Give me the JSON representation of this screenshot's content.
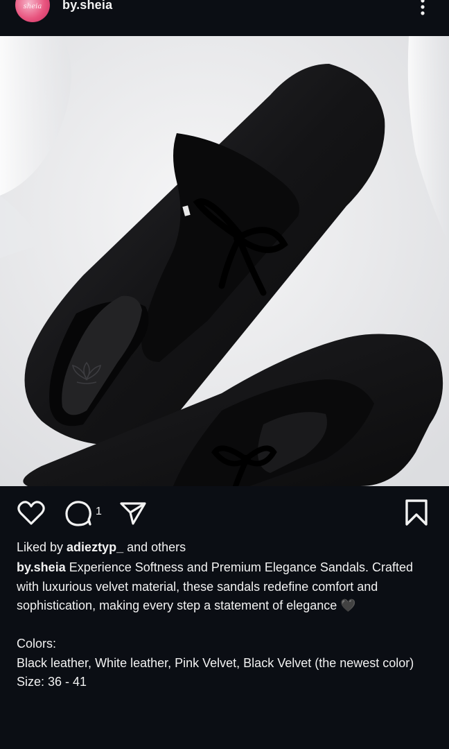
{
  "header": {
    "avatar_text": "sheia",
    "username": "by.sheia",
    "more_icon": "vertical-dots-icon"
  },
  "post": {
    "image_alt": "Black velvet mule sandals with bow detail",
    "icons": [
      "heart-icon",
      "comment-icon",
      "paper-plane-icon",
      "bookmark-icon"
    ],
    "comment_count": "1"
  },
  "likes": {
    "prefix": "Liked by ",
    "user": "adieztyp_",
    "suffix": " and others"
  },
  "caption": {
    "username": "by.sheia",
    "text": " Experience Softness and Premium Elegance Sandals. Crafted with luxurious velvet material, these sandals redefine comfort and sophistication, making every step a statement of elegance 🖤\n\nColors:\nBlack leather, White leather, Pink Velvet, Black Velvet (the newest color)\nSize: 36 - 41"
  }
}
